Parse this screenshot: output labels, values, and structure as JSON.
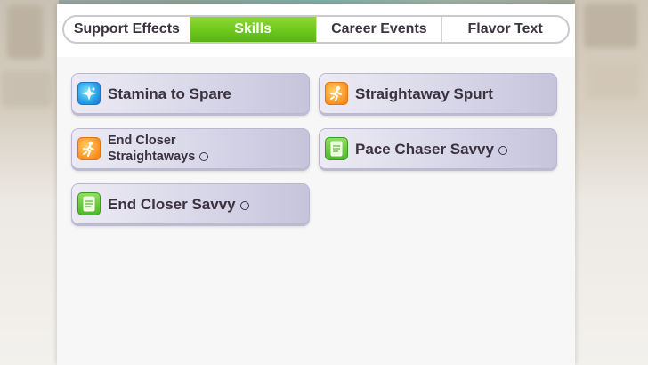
{
  "tabs": [
    {
      "label": "Support Effects",
      "active": false
    },
    {
      "label": "Skills",
      "active": true
    },
    {
      "label": "Career Events",
      "active": false
    },
    {
      "label": "Flavor Text",
      "active": false
    }
  ],
  "skills": [
    {
      "name": "Stamina to Spare",
      "icon": "stamina-skill-icon",
      "marker": ""
    },
    {
      "name": "Straightaway Spurt",
      "icon": "speed-skill-icon",
      "marker": ""
    },
    {
      "name_line1": "End Closer",
      "name_line2": "Straightaways",
      "icon": "speed-skill-icon",
      "marker": "○"
    },
    {
      "name": "Pace Chaser Savvy",
      "icon": "savvy-skill-icon",
      "marker": "○"
    },
    {
      "name": "End Closer Savvy",
      "icon": "savvy-skill-icon",
      "marker": "○"
    }
  ],
  "colors": {
    "active_tab": "#6cc81c",
    "skill_card": "#d8d7e8",
    "text": "#3b3240"
  }
}
